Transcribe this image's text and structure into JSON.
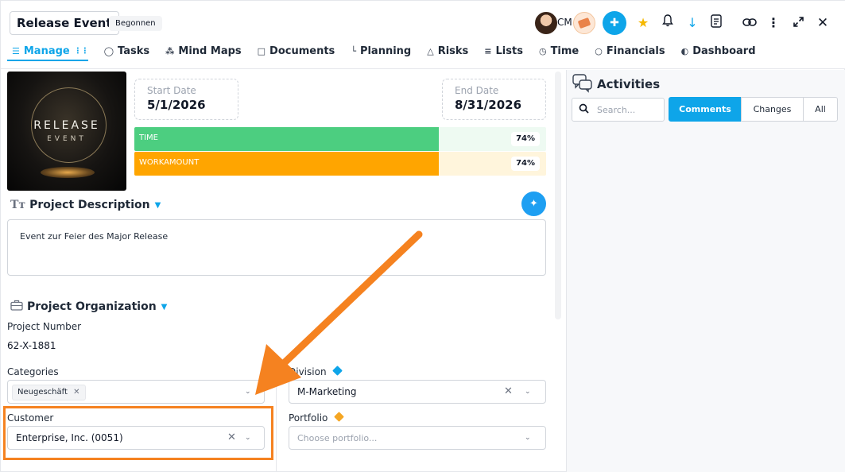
{
  "project": {
    "title": "Release Event",
    "status": "Begonnen",
    "initials": "CM"
  },
  "tabs": [
    {
      "label": "Manage",
      "icon": "sliders-icon"
    },
    {
      "label": "Tasks",
      "icon": "check-circle-icon"
    },
    {
      "label": "Mind Maps",
      "icon": "mind-map-icon"
    },
    {
      "label": "Documents",
      "icon": "folder-icon"
    },
    {
      "label": "Planning",
      "icon": "gantt-icon"
    },
    {
      "label": "Risks",
      "icon": "warning-icon"
    },
    {
      "label": "Lists",
      "icon": "list-icon"
    },
    {
      "label": "Time",
      "icon": "clock-icon"
    },
    {
      "label": "Financials",
      "icon": "coins-icon"
    },
    {
      "label": "Dashboard",
      "icon": "dashboard-icon"
    }
  ],
  "hero_image": {
    "line1": "RELEASE",
    "line2": "EVENT"
  },
  "dates": {
    "start_label": "Start Date",
    "start_value": "5/1/2026",
    "end_label": "End Date",
    "end_value": "8/31/2026"
  },
  "progress": [
    {
      "label": "TIME",
      "percent": 74,
      "text": "74%",
      "color": "#4cce80",
      "track": "#eefaf2"
    },
    {
      "label": "WORKAMOUNT",
      "percent": 74,
      "text": "74%",
      "color": "#ffa500",
      "track": "#fff5dc"
    }
  ],
  "description": {
    "title": "Project Description",
    "text": "Event zur Feier des Major Release"
  },
  "organization": {
    "title": "Project Organization",
    "project_number_label": "Project Number",
    "project_number": "62-X-1881",
    "categories_label": "Categories",
    "categories_tag": "Neugeschäft",
    "division_label": "Division",
    "division_value": "M-Marketing",
    "customer_label": "Customer",
    "customer_value": "Enterprise, Inc. (0051)",
    "portfolio_label": "Portfolio",
    "portfolio_placeholder": "Choose portfolio..."
  },
  "activities": {
    "title": "Activities",
    "search_placeholder": "Search...",
    "segments": [
      "Comments",
      "Changes",
      "All"
    ]
  },
  "colors": {
    "accent": "#0ea5e9",
    "highlight": "#f58220",
    "premium_blue": "#0ea5e9",
    "premium_orange": "#f5a623"
  }
}
